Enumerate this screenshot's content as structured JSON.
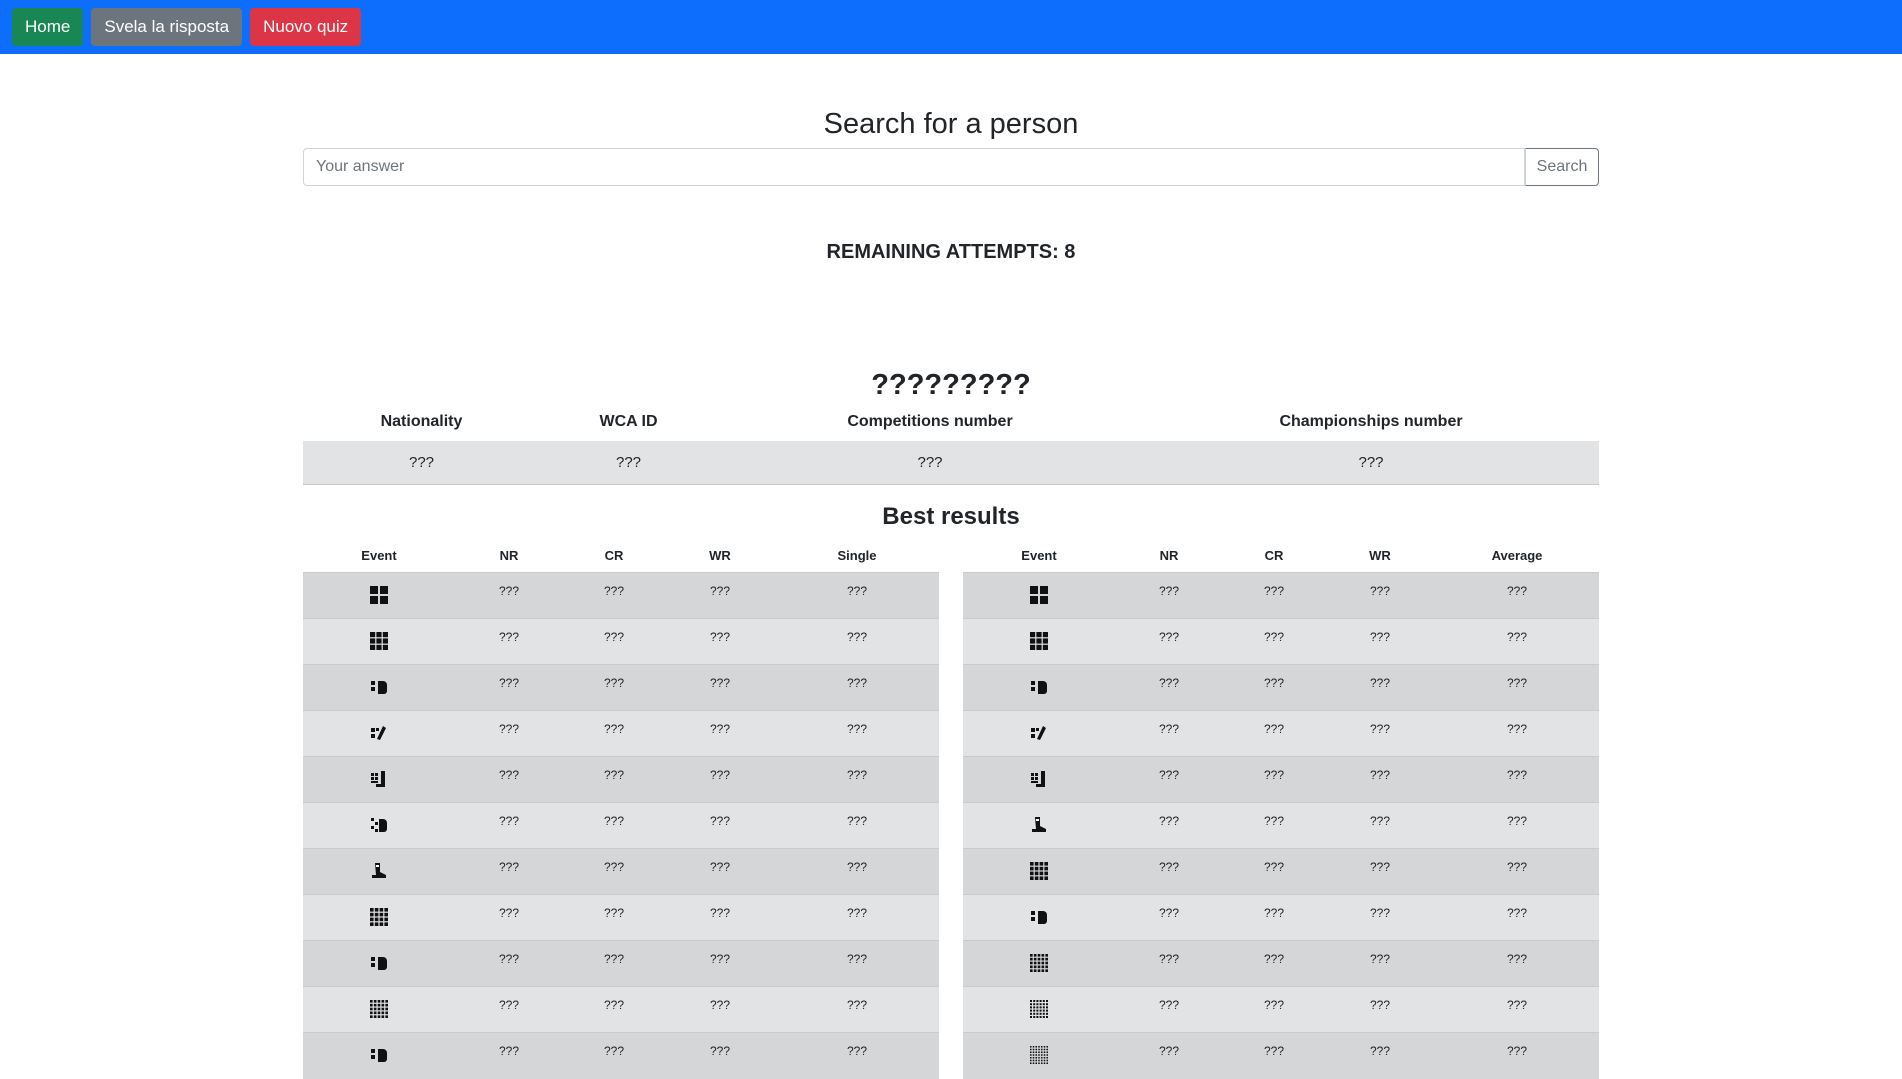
{
  "nav": {
    "home": "Home",
    "reveal": "Svela la risposta",
    "new_quiz": "Nuovo quiz"
  },
  "title": "Search for a person",
  "search": {
    "placeholder": "Your answer",
    "button": "Search"
  },
  "attempts": "REMAINING ATTEMPTS: 8",
  "person_name": "?????????",
  "info": {
    "headers": [
      "Nationality",
      "WCA ID",
      "Competitions number",
      "Championships number"
    ],
    "values": [
      "???",
      "???",
      "???",
      "???"
    ]
  },
  "best_results_title": "Best results",
  "single_table": {
    "headers": [
      "Event",
      "NR",
      "CR",
      "WR",
      "Single"
    ],
    "rows": [
      {
        "icon": "2x2-cube-icon",
        "nr": "???",
        "cr": "???",
        "wr": "???",
        "val": "???"
      },
      {
        "icon": "3x3-cube-icon",
        "nr": "???",
        "cr": "???",
        "wr": "???",
        "val": "???"
      },
      {
        "icon": "3x3-blindfolded-icon",
        "nr": "???",
        "cr": "???",
        "wr": "???",
        "val": "???"
      },
      {
        "icon": "3x3-one-handed-icon",
        "nr": "???",
        "cr": "???",
        "wr": "???",
        "val": "???"
      },
      {
        "icon": "3x3-fewest-moves-icon",
        "nr": "???",
        "cr": "???",
        "wr": "???",
        "val": "???"
      },
      {
        "icon": "3x3-multi-blind-icon",
        "nr": "???",
        "cr": "???",
        "wr": "???",
        "val": "???"
      },
      {
        "icon": "3x3-feet-icon",
        "nr": "???",
        "cr": "???",
        "wr": "???",
        "val": "???"
      },
      {
        "icon": "4x4-cube-icon",
        "nr": "???",
        "cr": "???",
        "wr": "???",
        "val": "???"
      },
      {
        "icon": "4x4-blindfolded-icon",
        "nr": "???",
        "cr": "???",
        "wr": "???",
        "val": "???"
      },
      {
        "icon": "5x5-cube-icon",
        "nr": "???",
        "cr": "???",
        "wr": "???",
        "val": "???"
      },
      {
        "icon": "5x5-blindfolded-icon",
        "nr": "???",
        "cr": "???",
        "wr": "???",
        "val": "???"
      }
    ]
  },
  "average_table": {
    "headers": [
      "Event",
      "NR",
      "CR",
      "WR",
      "Average"
    ],
    "rows": [
      {
        "icon": "2x2-cube-icon",
        "nr": "???",
        "cr": "???",
        "wr": "???",
        "val": "???"
      },
      {
        "icon": "3x3-cube-icon",
        "nr": "???",
        "cr": "???",
        "wr": "???",
        "val": "???"
      },
      {
        "icon": "3x3-blindfolded-icon",
        "nr": "???",
        "cr": "???",
        "wr": "???",
        "val": "???"
      },
      {
        "icon": "3x3-one-handed-icon",
        "nr": "???",
        "cr": "???",
        "wr": "???",
        "val": "???"
      },
      {
        "icon": "3x3-fewest-moves-icon",
        "nr": "???",
        "cr": "???",
        "wr": "???",
        "val": "???"
      },
      {
        "icon": "3x3-feet-icon",
        "nr": "???",
        "cr": "???",
        "wr": "???",
        "val": "???"
      },
      {
        "icon": "4x4-cube-icon",
        "nr": "???",
        "cr": "???",
        "wr": "???",
        "val": "???"
      },
      {
        "icon": "4x4-blindfolded-icon",
        "nr": "???",
        "cr": "???",
        "wr": "???",
        "val": "???"
      },
      {
        "icon": "5x5-cube-icon",
        "nr": "???",
        "cr": "???",
        "wr": "???",
        "val": "???"
      },
      {
        "icon": "6x6-cube-icon",
        "nr": "???",
        "cr": "???",
        "wr": "???",
        "val": "???"
      },
      {
        "icon": "7x7-cube-icon",
        "nr": "???",
        "cr": "???",
        "wr": "???",
        "val": "???"
      }
    ]
  }
}
